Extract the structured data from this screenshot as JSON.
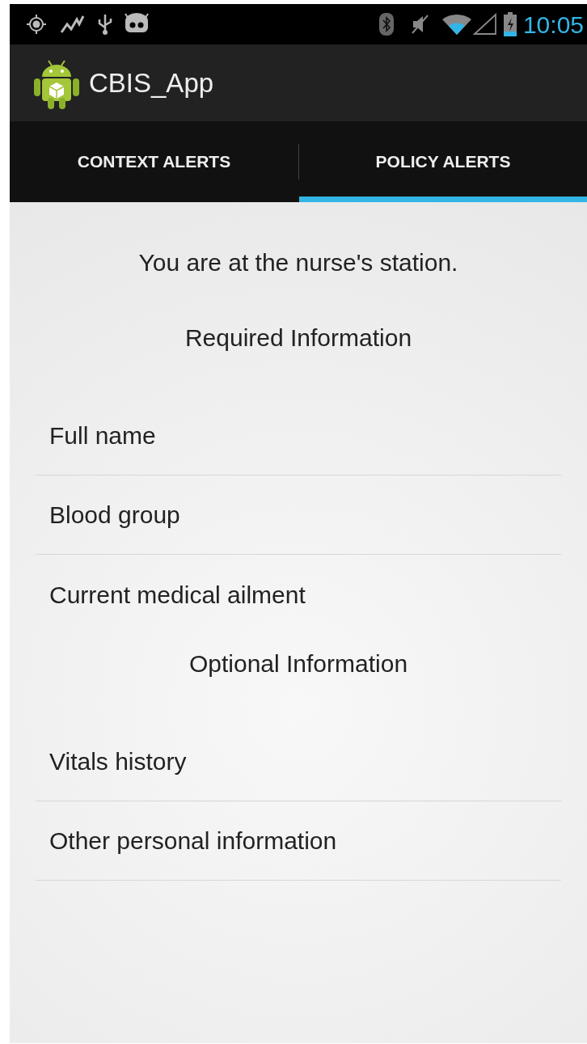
{
  "status_bar": {
    "time": "10:05"
  },
  "action_bar": {
    "title": "CBIS_App"
  },
  "tabs": [
    {
      "label": "CONTEXT ALERTS",
      "selected": false
    },
    {
      "label": "POLICY ALERTS",
      "selected": true
    }
  ],
  "location_message": "You are at the nurse's station.",
  "sections": [
    {
      "title": "Required Information",
      "clipped": true,
      "items": [
        "Full name",
        "Blood group",
        "Current medical ailment"
      ]
    },
    {
      "title": "Optional Information",
      "clipped": false,
      "items": [
        "Vitals history",
        "Other personal information"
      ]
    }
  ]
}
